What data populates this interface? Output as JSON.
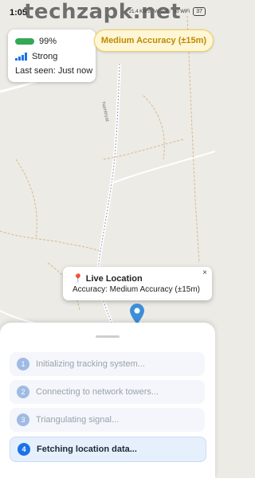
{
  "status_bar": {
    "time": "1:05",
    "net_speed": "21.4 KB/S",
    "network_1": "Vo WiFi",
    "network_2": "Vo WiFi",
    "battery": "37"
  },
  "watermark": "techzapk.net",
  "info_card": {
    "battery_percent": "99%",
    "battery_level": 0.99,
    "signal_label": "Strong",
    "last_seen": "Last seen: Just now"
  },
  "accuracy_pill": "Medium Accuracy (±15m)",
  "map": {
    "road_label": "Nambiyat"
  },
  "popup": {
    "title": "Live Location",
    "accuracy": "Accuracy: Medium Accuracy (±15m)",
    "close_symbol": "×"
  },
  "steps": [
    {
      "number": "1",
      "label": "Initializing tracking system...",
      "state": "done"
    },
    {
      "number": "2",
      "label": "Connecting to network towers...",
      "state": "done"
    },
    {
      "number": "3",
      "label": "Triangulating signal...",
      "state": "done"
    },
    {
      "number": "4",
      "label": "Fetching location data...",
      "state": "active"
    }
  ],
  "colors": {
    "accent": "#1a73e8",
    "battery_green": "#34a853",
    "accuracy_text": "#c08a00",
    "pin_blue": "#3b8fd9"
  }
}
